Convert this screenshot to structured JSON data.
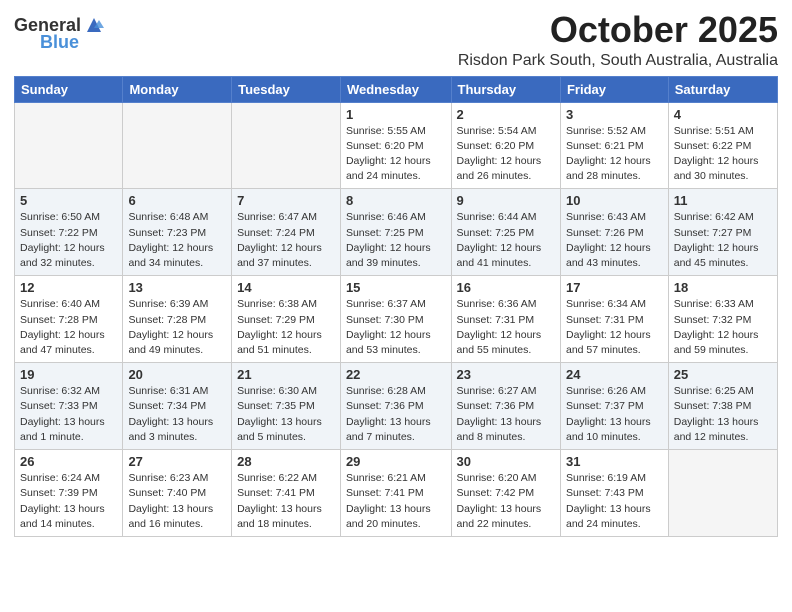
{
  "header": {
    "logo_general": "General",
    "logo_blue": "Blue",
    "month": "October 2025",
    "location": "Risdon Park South, South Australia, Australia"
  },
  "days_of_week": [
    "Sunday",
    "Monday",
    "Tuesday",
    "Wednesday",
    "Thursday",
    "Friday",
    "Saturday"
  ],
  "weeks": [
    [
      {
        "day": "",
        "info": ""
      },
      {
        "day": "",
        "info": ""
      },
      {
        "day": "",
        "info": ""
      },
      {
        "day": "1",
        "info": "Sunrise: 5:55 AM\nSunset: 6:20 PM\nDaylight: 12 hours\nand 24 minutes."
      },
      {
        "day": "2",
        "info": "Sunrise: 5:54 AM\nSunset: 6:20 PM\nDaylight: 12 hours\nand 26 minutes."
      },
      {
        "day": "3",
        "info": "Sunrise: 5:52 AM\nSunset: 6:21 PM\nDaylight: 12 hours\nand 28 minutes."
      },
      {
        "day": "4",
        "info": "Sunrise: 5:51 AM\nSunset: 6:22 PM\nDaylight: 12 hours\nand 30 minutes."
      }
    ],
    [
      {
        "day": "5",
        "info": "Sunrise: 6:50 AM\nSunset: 7:22 PM\nDaylight: 12 hours\nand 32 minutes."
      },
      {
        "day": "6",
        "info": "Sunrise: 6:48 AM\nSunset: 7:23 PM\nDaylight: 12 hours\nand 34 minutes."
      },
      {
        "day": "7",
        "info": "Sunrise: 6:47 AM\nSunset: 7:24 PM\nDaylight: 12 hours\nand 37 minutes."
      },
      {
        "day": "8",
        "info": "Sunrise: 6:46 AM\nSunset: 7:25 PM\nDaylight: 12 hours\nand 39 minutes."
      },
      {
        "day": "9",
        "info": "Sunrise: 6:44 AM\nSunset: 7:25 PM\nDaylight: 12 hours\nand 41 minutes."
      },
      {
        "day": "10",
        "info": "Sunrise: 6:43 AM\nSunset: 7:26 PM\nDaylight: 12 hours\nand 43 minutes."
      },
      {
        "day": "11",
        "info": "Sunrise: 6:42 AM\nSunset: 7:27 PM\nDaylight: 12 hours\nand 45 minutes."
      }
    ],
    [
      {
        "day": "12",
        "info": "Sunrise: 6:40 AM\nSunset: 7:28 PM\nDaylight: 12 hours\nand 47 minutes."
      },
      {
        "day": "13",
        "info": "Sunrise: 6:39 AM\nSunset: 7:28 PM\nDaylight: 12 hours\nand 49 minutes."
      },
      {
        "day": "14",
        "info": "Sunrise: 6:38 AM\nSunset: 7:29 PM\nDaylight: 12 hours\nand 51 minutes."
      },
      {
        "day": "15",
        "info": "Sunrise: 6:37 AM\nSunset: 7:30 PM\nDaylight: 12 hours\nand 53 minutes."
      },
      {
        "day": "16",
        "info": "Sunrise: 6:36 AM\nSunset: 7:31 PM\nDaylight: 12 hours\nand 55 minutes."
      },
      {
        "day": "17",
        "info": "Sunrise: 6:34 AM\nSunset: 7:31 PM\nDaylight: 12 hours\nand 57 minutes."
      },
      {
        "day": "18",
        "info": "Sunrise: 6:33 AM\nSunset: 7:32 PM\nDaylight: 12 hours\nand 59 minutes."
      }
    ],
    [
      {
        "day": "19",
        "info": "Sunrise: 6:32 AM\nSunset: 7:33 PM\nDaylight: 13 hours\nand 1 minute."
      },
      {
        "day": "20",
        "info": "Sunrise: 6:31 AM\nSunset: 7:34 PM\nDaylight: 13 hours\nand 3 minutes."
      },
      {
        "day": "21",
        "info": "Sunrise: 6:30 AM\nSunset: 7:35 PM\nDaylight: 13 hours\nand 5 minutes."
      },
      {
        "day": "22",
        "info": "Sunrise: 6:28 AM\nSunset: 7:36 PM\nDaylight: 13 hours\nand 7 minutes."
      },
      {
        "day": "23",
        "info": "Sunrise: 6:27 AM\nSunset: 7:36 PM\nDaylight: 13 hours\nand 8 minutes."
      },
      {
        "day": "24",
        "info": "Sunrise: 6:26 AM\nSunset: 7:37 PM\nDaylight: 13 hours\nand 10 minutes."
      },
      {
        "day": "25",
        "info": "Sunrise: 6:25 AM\nSunset: 7:38 PM\nDaylight: 13 hours\nand 12 minutes."
      }
    ],
    [
      {
        "day": "26",
        "info": "Sunrise: 6:24 AM\nSunset: 7:39 PM\nDaylight: 13 hours\nand 14 minutes."
      },
      {
        "day": "27",
        "info": "Sunrise: 6:23 AM\nSunset: 7:40 PM\nDaylight: 13 hours\nand 16 minutes."
      },
      {
        "day": "28",
        "info": "Sunrise: 6:22 AM\nSunset: 7:41 PM\nDaylight: 13 hours\nand 18 minutes."
      },
      {
        "day": "29",
        "info": "Sunrise: 6:21 AM\nSunset: 7:41 PM\nDaylight: 13 hours\nand 20 minutes."
      },
      {
        "day": "30",
        "info": "Sunrise: 6:20 AM\nSunset: 7:42 PM\nDaylight: 13 hours\nand 22 minutes."
      },
      {
        "day": "31",
        "info": "Sunrise: 6:19 AM\nSunset: 7:43 PM\nDaylight: 13 hours\nand 24 minutes."
      },
      {
        "day": "",
        "info": ""
      }
    ]
  ]
}
